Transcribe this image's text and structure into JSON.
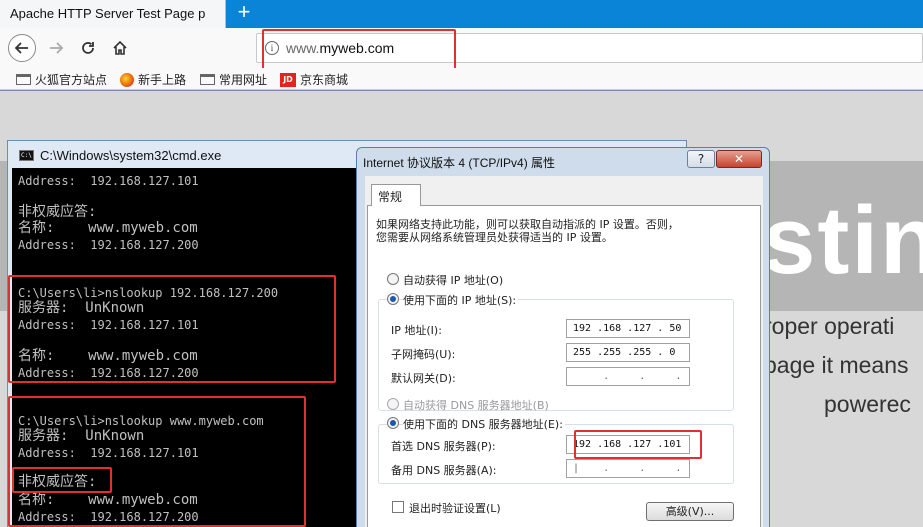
{
  "browser": {
    "tab_title": "Apache HTTP Server Test Page p",
    "tab_close": "✕",
    "new_tab": "+",
    "url_prefix": "www.",
    "url_domain": "myweb.com",
    "bookmarks": [
      "火狐官方站点",
      "新手上路",
      "常用网址",
      "京东商城"
    ],
    "jd_icon_text": "JD"
  },
  "page": {
    "big_text": "stin",
    "line1": "roper operati",
    "line2": "page it means",
    "line3": "powerec"
  },
  "cmd": {
    "title": "C:\\Windows\\system32\\cmd.exe",
    "icon_text": "C:\\",
    "lines": [
      "Address:  192.168.127.101",
      "非权威应答:",
      "名称:    www.myweb.com",
      "Address:  192.168.127.200",
      "C:\\Users\\li>nslookup 192.168.127.200",
      "服务器:  UnKnown",
      "Address:  192.168.127.101",
      "名称:    www.myweb.com",
      "Address:  192.168.127.200",
      "C:\\Users\\li>nslookup www.myweb.com",
      "服务器:  UnKnown",
      "Address:  192.168.127.101",
      "非权威应答:",
      "名称:    www.myweb.com",
      "Address:  192.168.127.200"
    ]
  },
  "dialog": {
    "title": "Internet 协议版本 4 (TCP/IPv4) 属性",
    "help": "?",
    "close": "✕",
    "tab": "常规",
    "desc1": "如果网络支持此功能，则可以获取自动指派的 IP 设置。否则，",
    "desc2": "您需要从网络系统管理员处获得适当的 IP 设置。",
    "auto_ip": "自动获得 IP 地址(O)",
    "manual_ip": "使用下面的 IP 地址(S):",
    "ip_label": "IP 地址(I):",
    "ip_value": "192 .168 .127 . 50",
    "mask_label": "子网掩码(U):",
    "mask_value": "255 .255 .255 . 0",
    "gw_label": "默认网关(D):",
    "gw_value": "     .     .     .",
    "auto_dns": "自动获得 DNS 服务器地址(B)",
    "manual_dns": "使用下面的 DNS 服务器地址(E):",
    "dns1_label": "首选 DNS 服务器(P):",
    "dns1_value": "192 .168 .127 .101",
    "dns2_label": "备用 DNS 服务器(A):",
    "dns2_value": "|    .     .     .",
    "validate": "退出时验证设置(L)",
    "advanced": "高级(V)..."
  },
  "colors": {
    "highlight_box": "#e03131",
    "tab_strip": "#0a84d6",
    "console_bg": "#000000",
    "console_fg": "#c0c0c0"
  }
}
